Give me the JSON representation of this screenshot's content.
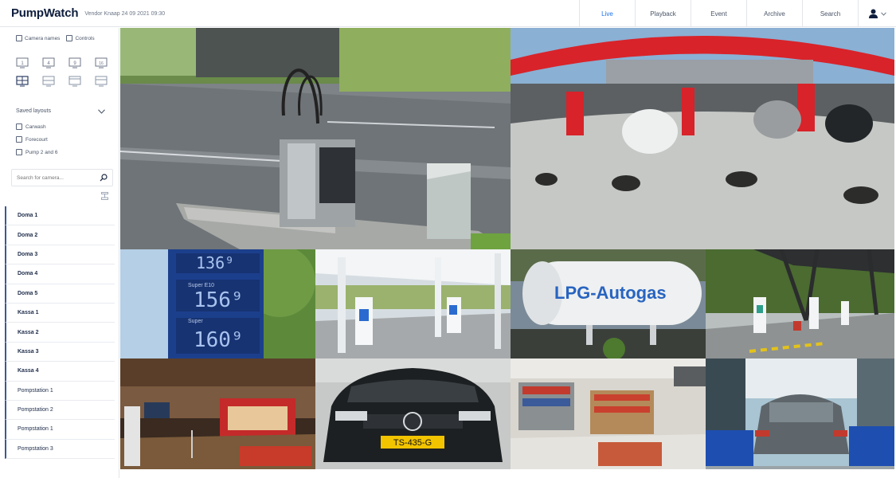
{
  "header": {
    "brand": "PumpWatch",
    "subtitle": "Vendor Knaap  24 09 2021  09:30",
    "tabs": [
      {
        "label": "Live",
        "active": true
      },
      {
        "label": "Playback",
        "active": false
      },
      {
        "label": "Event",
        "active": false
      },
      {
        "label": "Archive",
        "active": false
      },
      {
        "label": "Search",
        "active": false
      }
    ],
    "user_icon": "user-icon"
  },
  "sidebar": {
    "checkboxes": [
      {
        "label": "Camera names",
        "checked": false
      },
      {
        "label": "Controls",
        "checked": false
      }
    ],
    "saved_layouts_label": "Saved layouts",
    "saved_layouts": [
      {
        "label": "Carwash",
        "checked": false
      },
      {
        "label": "Forecourt",
        "checked": false
      },
      {
        "label": "Pump 2 and 6",
        "checked": false
      }
    ],
    "search_placeholder": "Search for camera...",
    "cameras": [
      "Doma 1",
      "Doma 2",
      "Doma 3",
      "Doma 4",
      "Doma 5",
      "Kassa 1",
      "Kassa 2",
      "Kassa 3",
      "Kassa 4",
      "Pompstation 1",
      "Pompstation 2",
      "Pompstation 1",
      "Pompstation 3"
    ]
  },
  "video_tiles": [
    {
      "scene": "ev-charger-roadside"
    },
    {
      "scene": "gas-station-forecourt-fisheye"
    },
    {
      "scene": "fuel-price-sign",
      "prices": [
        "1.36 9",
        "1.56 9",
        "1.60 9"
      ],
      "labels": [
        "Super E10",
        "Super"
      ]
    },
    {
      "scene": "canopy-pump-island"
    },
    {
      "scene": "lpg-tank",
      "text": "LPG-Autogas"
    },
    {
      "scene": "ev-charging-canopy"
    },
    {
      "scene": "shop-interior"
    },
    {
      "scene": "vw-car-front",
      "plate": "TS-435-G"
    },
    {
      "scene": "convenience-store"
    },
    {
      "scene": "car-wash"
    }
  ]
}
